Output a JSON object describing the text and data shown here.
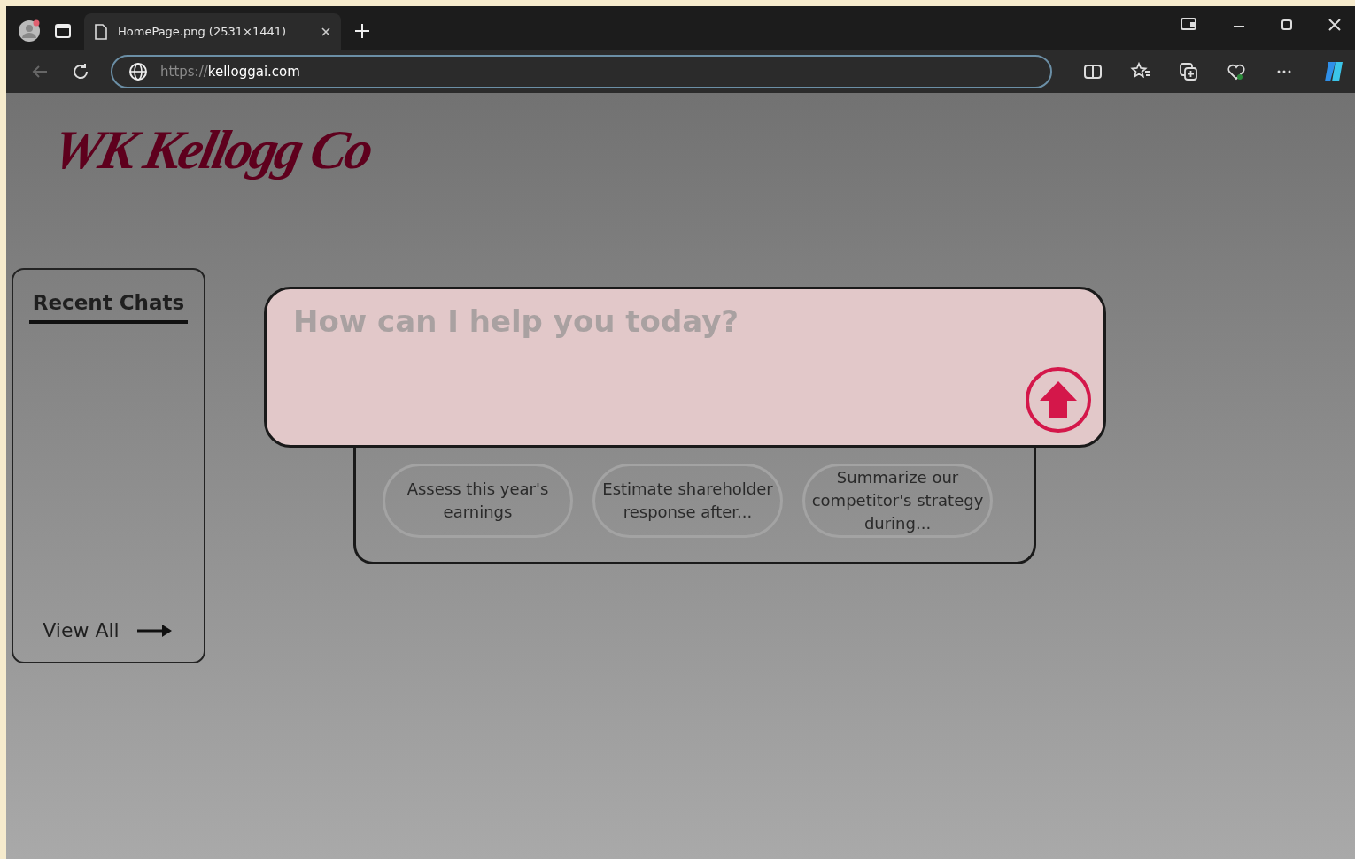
{
  "browser": {
    "tabs": [
      {
        "title": "HomePage.png (2531×1441)",
        "selected": true
      }
    ],
    "address": {
      "scheme": "https://",
      "host": "kelloggai.com"
    }
  },
  "logo": {
    "text": "WK Kellogg Co"
  },
  "sidebar": {
    "title": "Recent Chats",
    "view_all": "View All"
  },
  "prompt": {
    "placeholder": "How can I help you today?"
  },
  "suggestions": [
    {
      "text": "Assess this year's earnings"
    },
    {
      "text": "Estimate shareholder response after..."
    },
    {
      "text": "Summarize our competitor's strategy during..."
    }
  ]
}
